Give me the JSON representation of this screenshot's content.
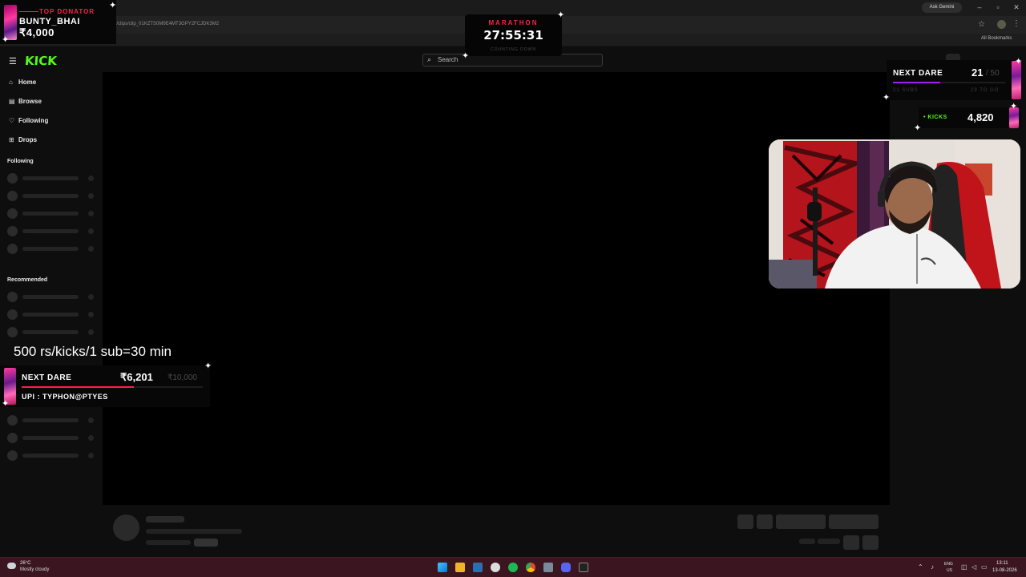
{
  "browser": {
    "url": "...ayzz/clips/clip_01KZTS0M9E4MT3GPY2FCJDK3M2",
    "ask_gemini": "Ask Gemini",
    "all_bookmarks": "All Bookmarks",
    "window_controls": [
      "–",
      "▫",
      "✕"
    ]
  },
  "site": {
    "logo": "KICK",
    "search_placeholder": "Search",
    "nav": [
      {
        "label": "Home",
        "icon": "home-icon"
      },
      {
        "label": "Browse",
        "icon": "browse-icon"
      },
      {
        "label": "Following",
        "icon": "heart-icon"
      },
      {
        "label": "Drops",
        "icon": "drops-icon"
      }
    ],
    "following_label": "Following",
    "recommended_label": "Recommended"
  },
  "overlay": {
    "top_donator": {
      "label": "TOP DONATOR",
      "name": "BUNTY_BHAI",
      "amount": "₹4,000"
    },
    "marathon": {
      "label": "MARATHON",
      "time": "27:55:31",
      "sub": "COUNTING DOWN"
    },
    "next_dare_subs": {
      "label": "NEXT DARE",
      "count": "21",
      "total": "/ 50",
      "sub_left": "21 SUBS",
      "sub_right": "29 TO GO",
      "progress": 0.42
    },
    "kicks": {
      "label": "• KICKS",
      "count": "4,820"
    },
    "rate_text": "500 rs/kicks/1 sub=30 min",
    "next_dare_money": {
      "label": "NEXT DARE",
      "amount": "₹6,201",
      "goal": "₹10,000",
      "upi": "UPI : TYPHON@PTYES",
      "progress": 0.62
    }
  },
  "taskbar": {
    "weather_temp": "26°C",
    "weather_cond": "Mostly cloudy",
    "lang1": "ENG",
    "lang2": "US",
    "time": "13:11",
    "date": "13-08-2026"
  }
}
